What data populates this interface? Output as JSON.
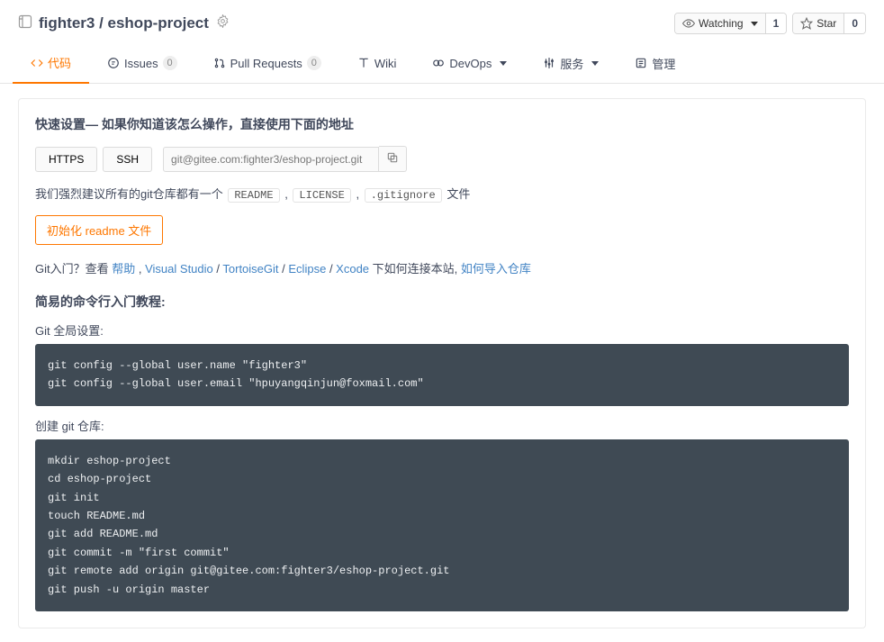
{
  "header": {
    "owner": "fighter3",
    "separator": " / ",
    "repo": "eshop-project",
    "watch_label": "Watching",
    "watch_count": "1",
    "star_label": "Star",
    "star_count": "0"
  },
  "tabs": {
    "code": "代码",
    "issues": "Issues",
    "issues_count": "0",
    "pulls": "Pull Requests",
    "pulls_count": "0",
    "wiki": "Wiki",
    "devops": "DevOps",
    "services": "服务",
    "manage": "管理"
  },
  "setup": {
    "title": "快速设置— 如果你知道该怎么操作，直接使用下面的地址",
    "https_btn": "HTTPS",
    "ssh_btn": "SSH",
    "clone_url": "git@gitee.com:fighter3/eshop-project.git",
    "recommend_prefix": "我们强烈建议所有的git仓库都有一个 ",
    "readme_tag": "README",
    "license_tag": "LICENSE",
    "gitignore_tag": ".gitignore",
    "recommend_suffix": " 文件",
    "comma": ", ",
    "init_readme_btn": "初始化 readme 文件",
    "git_intro_prefix": "Git入门？查看 ",
    "help_link": "帮助",
    "vs_link": "Visual Studio",
    "tortoise_link": "TortoiseGit",
    "eclipse_link": "Eclipse",
    "xcode_link": "Xcode",
    "git_intro_middle": " 下如何连接本站, ",
    "import_link": "如何导入仓库",
    "sep": " , ",
    "slash": " / "
  },
  "cli": {
    "section_title": "简易的命令行入门教程:",
    "global_label": "Git 全局设置:",
    "global_code": "git config --global user.name \"fighter3\"\ngit config --global user.email \"hpuyangqinjun@foxmail.com\"",
    "create_label": "创建 git 仓库:",
    "create_code": "mkdir eshop-project\ncd eshop-project\ngit init\ntouch README.md\ngit add README.md\ngit commit -m \"first commit\"\ngit remote add origin git@gitee.com:fighter3/eshop-project.git\ngit push -u origin master"
  }
}
